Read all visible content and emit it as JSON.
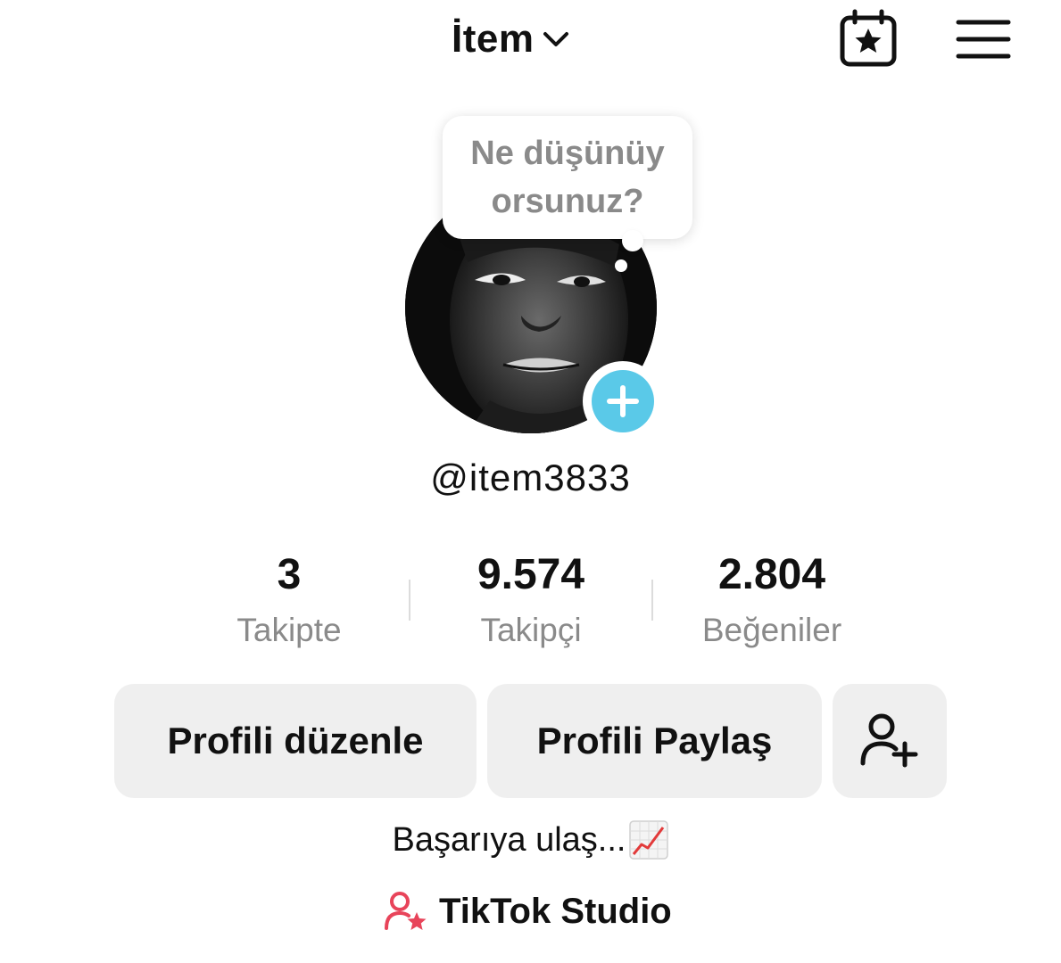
{
  "header": {
    "title": "İtem",
    "title_dropdown_icon": "chevron-down-icon",
    "calendar_icon": "calendar-star-icon",
    "menu_icon": "hamburger-menu-icon"
  },
  "profile": {
    "bubble_text": "Ne düşünüyorsunuz?",
    "username": "@item3833",
    "add_badge_icon": "plus-icon",
    "accent_color": "#5ac9e8"
  },
  "stats": [
    {
      "value": "3",
      "label": "Takipte"
    },
    {
      "value": "9.574",
      "label": "Takipçi"
    },
    {
      "value": "2.804",
      "label": "Beğeniler"
    }
  ],
  "buttons": {
    "edit_profile": "Profili düzenle",
    "share_profile": "Profili Paylaş",
    "add_friend_icon": "add-user-icon"
  },
  "bio": {
    "text": "Başarıya ulaş...",
    "emoji": "chart-increasing-icon"
  },
  "studio": {
    "label": "TikTok Studio",
    "icon": "studio-user-star-icon",
    "icon_color": "#e8445a"
  }
}
